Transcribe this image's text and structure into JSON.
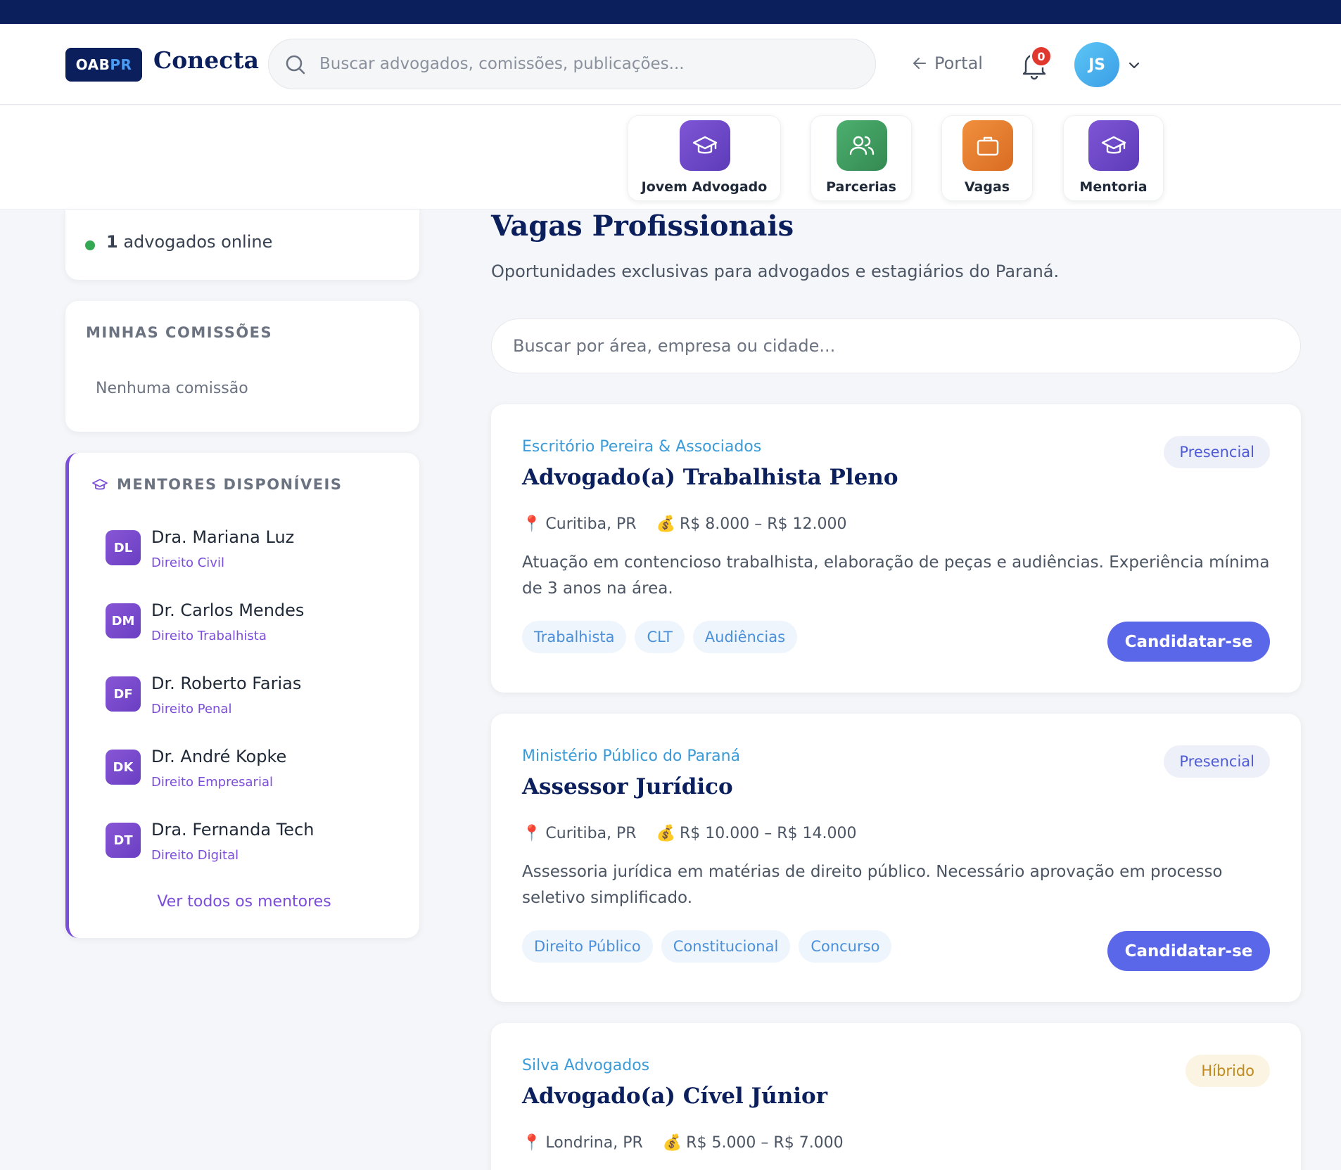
{
  "header": {
    "logo": {
      "oab": "OAB",
      "pr": "PR"
    },
    "brand": "Conecta",
    "search_placeholder": "Buscar advogados, comissões, publicações...",
    "portal_label": "Portal",
    "notifications_count": "0",
    "user_initials": "JS"
  },
  "nav": [
    {
      "label": "Jovem Advogado",
      "icon": "graduation-cap-icon",
      "color": "#6b46c1"
    },
    {
      "label": "Parcerias",
      "icon": "users-icon",
      "color": "#3f9a5b"
    },
    {
      "label": "Vagas",
      "icon": "briefcase-icon",
      "color": "#e07a2e"
    },
    {
      "label": "Mentoria",
      "icon": "graduation-cap-icon",
      "color": "#6b46c1"
    }
  ],
  "sidebar": {
    "online_count": "1",
    "online_label": "advogados online",
    "commissions_title": "MINHAS COMISSÕES",
    "commissions_empty": "Nenhuma comissão",
    "mentors_title": "MENTORES DISPONÍVEIS",
    "mentors": [
      {
        "initials": "DL",
        "name": "Dra. Mariana Luz",
        "area": "Direito Civil"
      },
      {
        "initials": "DM",
        "name": "Dr. Carlos Mendes",
        "area": "Direito Trabalhista"
      },
      {
        "initials": "DF",
        "name": "Dr. Roberto Farias",
        "area": "Direito Penal"
      },
      {
        "initials": "DK",
        "name": "Dr. André Kopke",
        "area": "Direito Empresarial"
      },
      {
        "initials": "DT",
        "name": "Dra. Fernanda Tech",
        "area": "Direito Digital"
      }
    ],
    "see_all_mentors": "Ver todos os mentores"
  },
  "main": {
    "title": "Vagas Profissionais",
    "subtitle": "Oportunidades exclusivas para advogados e estagiários do Paraná.",
    "search_placeholder": "Buscar por área, empresa ou cidade...",
    "jobs": [
      {
        "company": "Escritório Pereira & Associados",
        "title": "Advogado(a) Trabalhista Pleno",
        "mode": "Presencial",
        "location": "Curitiba, PR",
        "salary": "R$ 8.000 – R$ 12.000",
        "description": "Atuação em contencioso trabalhista, elaboração de peças e audiências. Experiência mínima de 3 anos na área.",
        "tags": [
          "Trabalhista",
          "CLT",
          "Audiências"
        ],
        "apply_label": "Candidatar-se"
      },
      {
        "company": "Ministério Público do Paraná",
        "title": "Assessor Jurídico",
        "mode": "Presencial",
        "location": "Curitiba, PR",
        "salary": "R$ 10.000 – R$ 14.000",
        "description": "Assessoria jurídica em matérias de direito público. Necessário aprovação em processo seletivo simplificado.",
        "tags": [
          "Direito Público",
          "Constitucional",
          "Concurso"
        ],
        "apply_label": "Candidatar-se"
      },
      {
        "company": "Silva Advogados",
        "title": "Advogado(a) Cível Júnior",
        "mode": "Híbrido",
        "location": "Londrina, PR",
        "salary": "R$ 5.000 – R$ 7.000"
      }
    ]
  },
  "colors": {
    "navy": "#0b1f5c",
    "accent": "#5a67e8",
    "mentor_purple": "#7c4ddb",
    "online_green": "#34a853"
  }
}
